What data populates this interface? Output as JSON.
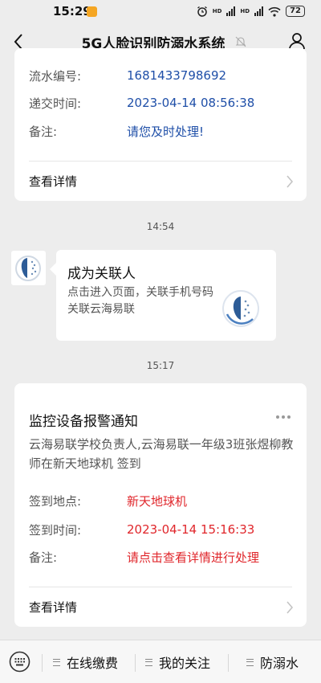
{
  "status_bar": {
    "time": "15:29",
    "signal_label_1": "HD",
    "signal_label_2": "HD",
    "battery": "72"
  },
  "nav": {
    "title": "5G人脸识别防溺水系统"
  },
  "card1": {
    "rows": [
      {
        "label": "流水编号:",
        "value": "1681433798692"
      },
      {
        "label": "递交时间:",
        "value": "2023-04-14 08:56:38"
      },
      {
        "label": "备注:",
        "value": "请您及时处理!"
      }
    ],
    "footer_label": "查看详情"
  },
  "sep1": {
    "time": "14:54"
  },
  "promo": {
    "title": "成为关联人",
    "description": "点击进入页面，关联手机号码关联云海易联"
  },
  "sep2": {
    "time": "15:17"
  },
  "card2": {
    "title": "监控设备报警通知",
    "description": "云海易联学校负责人,云海易联一年级3班张煜柳教师在新天地球机 签到",
    "rows": [
      {
        "label": "签到地点:",
        "value": "新天地球机"
      },
      {
        "label": "签到时间:",
        "value": "2023-04-14 15:16:33"
      },
      {
        "label": "备注:",
        "value": "请点击查看详情进行处理"
      }
    ],
    "footer_label": "查看详情"
  },
  "bottom_menu": {
    "items": [
      {
        "label": "在线缴费"
      },
      {
        "label": "我的关注"
      },
      {
        "label": "防溺水"
      }
    ]
  },
  "colors": {
    "link_blue": "#1f4fa8",
    "alert_red": "#e0262b",
    "background": "#ededed"
  }
}
